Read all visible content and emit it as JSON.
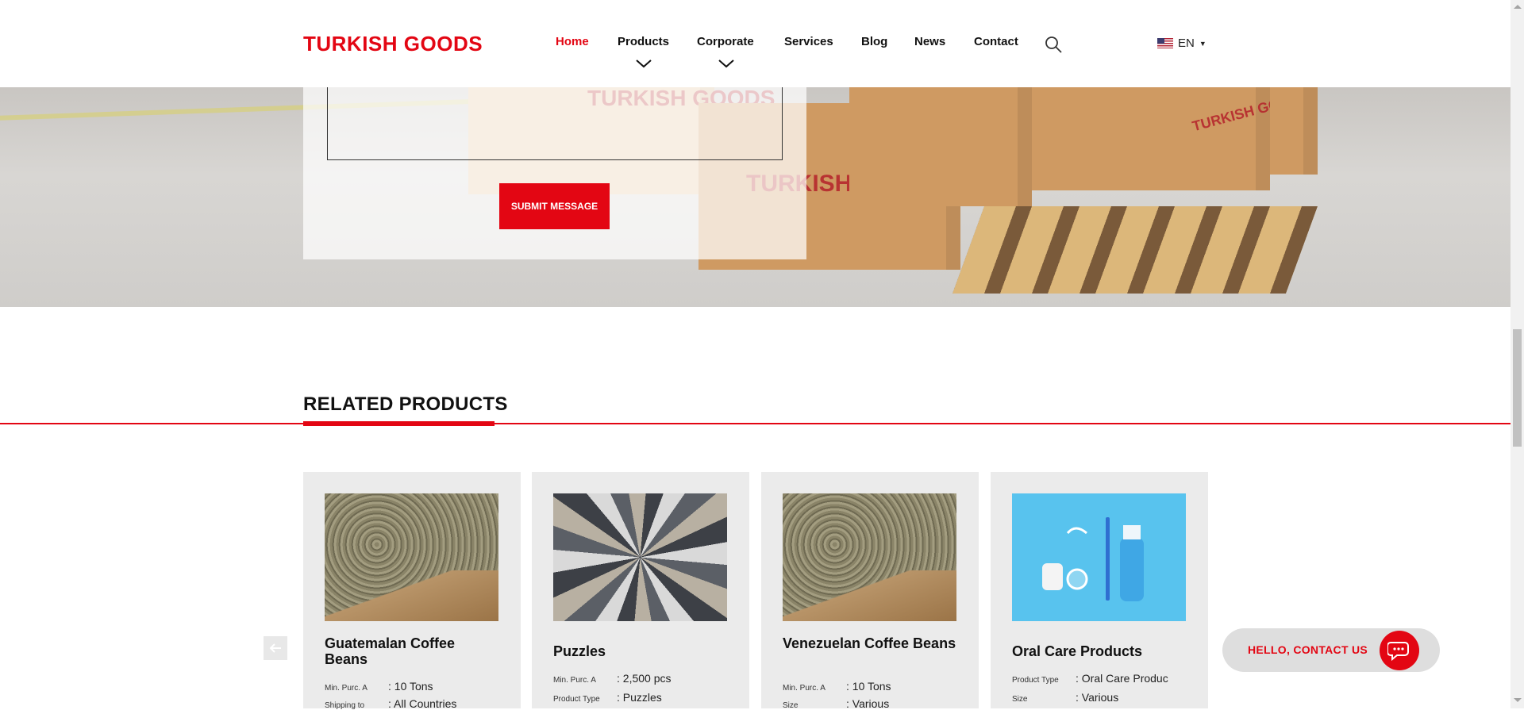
{
  "brand": {
    "logo_text": "TURKISH GOODS",
    "accent_color": "#e30613"
  },
  "nav": {
    "items": [
      {
        "label": "Home",
        "active": true
      },
      {
        "label": "Products",
        "has_dropdown": true
      },
      {
        "label": "Corporate",
        "has_dropdown": true
      },
      {
        "label": "Services"
      },
      {
        "label": "Blog"
      },
      {
        "label": "News"
      },
      {
        "label": "Contact"
      }
    ],
    "search_icon": "search-icon",
    "language": "EN"
  },
  "hero": {
    "box_stamp": "TURKISH GOODS",
    "submit_label": "SUBMIT MESSAGE"
  },
  "related": {
    "title": "RELATED PRODUCTS",
    "products": [
      {
        "name": "Guatemalan Coffee Beans",
        "image": "coffee-beans-image",
        "specs": [
          {
            "key": "Min. Purc. A",
            "value": ": 10 Tons"
          },
          {
            "key": "Shipping to",
            "value": ": All Countries"
          }
        ]
      },
      {
        "name": "Puzzles",
        "image": "puzzle-pieces-image",
        "specs": [
          {
            "key": "Min. Purc. A",
            "value": ": 2,500 pcs"
          },
          {
            "key": "Product Type",
            "value": ": Puzzles"
          }
        ]
      },
      {
        "name": "Venezuelan Coffee Beans",
        "image": "coffee-beans-image",
        "specs": [
          {
            "key": "Min. Purc. A",
            "value": ": 10 Tons"
          },
          {
            "key": "Size",
            "value": ": Various"
          }
        ]
      },
      {
        "name": "Oral Care Products",
        "image": "oral-care-image",
        "specs": [
          {
            "key": "Product Type",
            "value": ": Oral Care Produc"
          },
          {
            "key": "Size",
            "value": ": Various"
          }
        ]
      }
    ]
  },
  "contact_widget": {
    "label": "HELLO, CONTACT US",
    "icon": "chat-bubble-icon"
  }
}
